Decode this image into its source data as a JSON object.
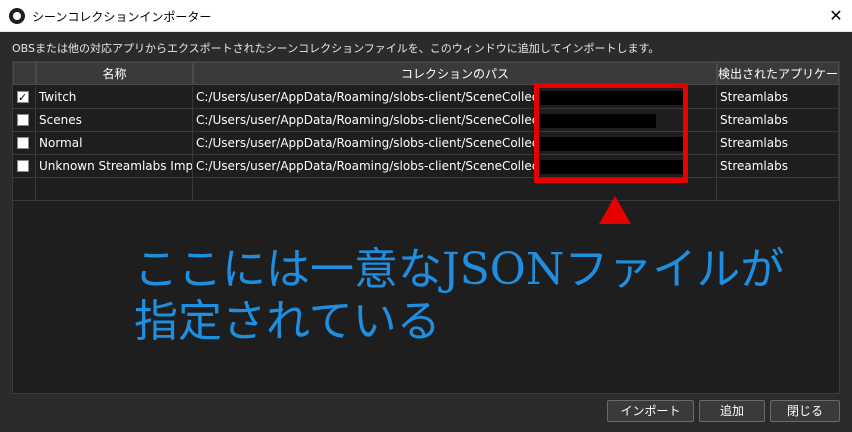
{
  "window": {
    "title": "シーンコレクションインポーター",
    "close_glyph": "✕"
  },
  "description": "OBSまたは他の対応アプリからエクスポートされたシーンコレクションファイルを、このウィンドウに追加してインポートします。",
  "table": {
    "headers": [
      "名称",
      "コレクションのパス",
      "検出されたアプリケーション"
    ],
    "rows": [
      {
        "checked": true,
        "name": "Twitch",
        "path": "C:/Users/user/AppData/Roaming/slobs-client/SceneCollections/",
        "app": "Streamlabs"
      },
      {
        "checked": false,
        "name": "Scenes",
        "path": "C:/Users/user/AppData/Roaming/slobs-client/SceneCollections/",
        "app": "Streamlabs"
      },
      {
        "checked": false,
        "name": "Normal",
        "path": "C:/Users/user/AppData/Roaming/slobs-client/SceneCollections/",
        "app": "Streamlabs"
      },
      {
        "checked": false,
        "name": "Unknown Streamlabs Import",
        "path": "C:/Users/user/AppData/Roaming/slobs-client/SceneCollections/",
        "app": "Streamlabs"
      }
    ]
  },
  "annotation": {
    "line1": "ここには一意なJSONファイルが",
    "line2": "指定されている",
    "color": "#1e8fe0",
    "highlight_color": "#e60000"
  },
  "buttons": {
    "import": "インポート",
    "add": "追加",
    "close": "閉じる"
  },
  "icons": {
    "app": "obs-logo-icon",
    "close": "close-icon",
    "arrow": "red-triangle-arrow"
  }
}
